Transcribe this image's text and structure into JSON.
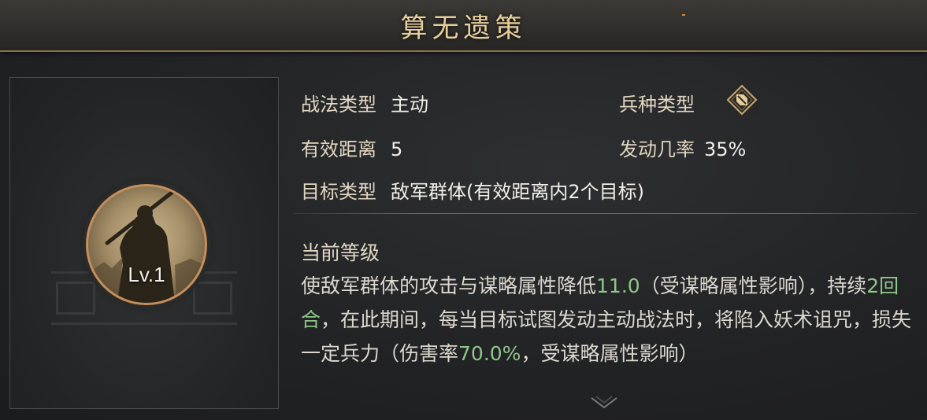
{
  "title": "算无遗策",
  "level_badge": "Lv.1",
  "tactic_type": {
    "label": "战法类型",
    "value": "主动"
  },
  "troop_type": {
    "label": "兵种类型",
    "icon": "troop-type-icon"
  },
  "effective_range": {
    "label": "有效距离",
    "value": "5"
  },
  "trigger_rate": {
    "label": "发动几率",
    "value": "35%"
  },
  "target_type": {
    "label": "目标类型",
    "value": "敌军群体(有效距离内2个目标)"
  },
  "current_level": {
    "heading": "当前等级",
    "desc_part1": "使敌军群体的攻击与谋略属性降低",
    "desc_value1": "11.0",
    "desc_part2": "（受谋略属性影响），持续",
    "desc_value2": "2回合",
    "desc_part3": "，在此期间，每当目标试图发动主动战法时，将陷入妖术诅咒，损失一定兵力（伤害率",
    "desc_value3": "70.0%",
    "desc_part4": "，受谋略属性影响）"
  },
  "colors": {
    "gold": "#e7cf9c",
    "highlight": "#8fc78a",
    "border": "#8a7248"
  }
}
